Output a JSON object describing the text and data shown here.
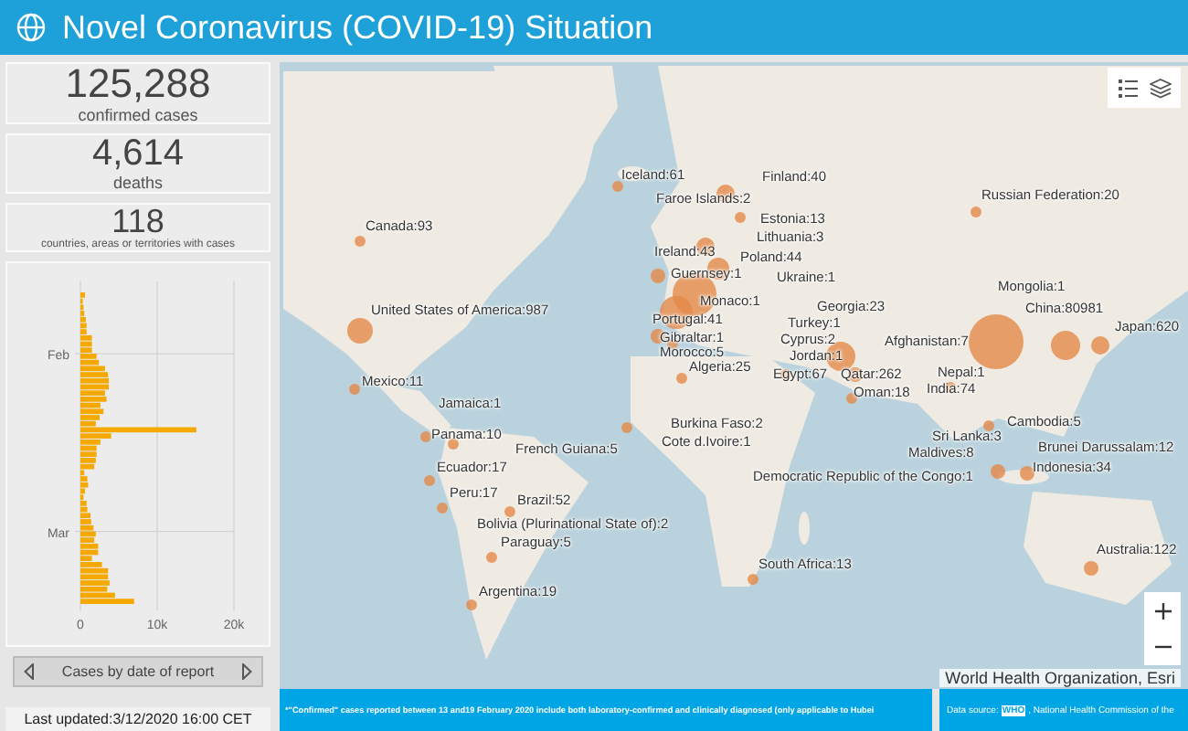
{
  "header": {
    "title": "Novel Coronavirus (COVID-19) Situation"
  },
  "stats": [
    {
      "value": "125,288",
      "label": "confirmed cases"
    },
    {
      "value": "4,614",
      "label": "deaths"
    },
    {
      "value": "118",
      "label": "countries, areas or territories with cases"
    }
  ],
  "chart": {
    "month_labels": [
      "Feb",
      "Mar"
    ],
    "value_labels": [
      "0",
      "10k",
      "20k"
    ]
  },
  "carousel": {
    "label": "Cases by date of report"
  },
  "last_updated": "Last updated:3/12/2020 16:00 CET",
  "map": {
    "labels": [
      {
        "text": "Iceland:61"
      },
      {
        "text": "Faroe Islands:2"
      },
      {
        "text": "Finland:40"
      },
      {
        "text": "Estonia:13"
      },
      {
        "text": "Lithuania:3"
      },
      {
        "text": "Poland:44"
      },
      {
        "text": "Ukraine:1"
      },
      {
        "text": "Ireland:43"
      },
      {
        "text": "Guernsey:1"
      },
      {
        "text": "Monaco:1"
      },
      {
        "text": "Portugal:41"
      },
      {
        "text": "Gibraltar:1"
      },
      {
        "text": "Morocco:5"
      },
      {
        "text": "Algeria:25"
      },
      {
        "text": "Georgia:23"
      },
      {
        "text": "Turkey:1"
      },
      {
        "text": "Cyprus:2"
      },
      {
        "text": "Jordan:1"
      },
      {
        "text": "Egypt:67"
      },
      {
        "text": "Qatar:262"
      },
      {
        "text": "Afghanistan:7"
      },
      {
        "text": "Oman:18"
      },
      {
        "text": "Nepal:1"
      },
      {
        "text": "India:74"
      },
      {
        "text": "Mongolia:1"
      },
      {
        "text": "China:80981"
      },
      {
        "text": "Japan:620"
      },
      {
        "text": "Russian Federation:20"
      },
      {
        "text": "Canada:93"
      },
      {
        "text": "United States of America:987"
      },
      {
        "text": "Mexico:11"
      },
      {
        "text": "Jamaica:1"
      },
      {
        "text": "Panama:10"
      },
      {
        "text": "French Guiana:5"
      },
      {
        "text": "Ecuador:17"
      },
      {
        "text": "Peru:17"
      },
      {
        "text": "Brazil:52"
      },
      {
        "text": "Bolivia (Plurinational State of):2"
      },
      {
        "text": "Paraguay:5"
      },
      {
        "text": "Argentina:19"
      },
      {
        "text": "Burkina Faso:2"
      },
      {
        "text": "Cote d.Ivoire:1"
      },
      {
        "text": "Cambodia:5"
      },
      {
        "text": "Sri Lanka:3"
      },
      {
        "text": "Brunei Darussalam:12"
      },
      {
        "text": "Maldives:8"
      },
      {
        "text": "Indonesia:34"
      },
      {
        "text": "Democratic Republic of the Congo:1"
      },
      {
        "text": "South Africa:13"
      },
      {
        "text": "Australia:122"
      }
    ],
    "attribution": "World Health Organization, Esri"
  },
  "footer": {
    "note": "*\"Confirmed\" cases reported between 13 and19 February 2020 include both laboratory-confirmed and clinically diagnosed (only  applicable to Hubei",
    "source_prefix": "Data source:",
    "source_link": "WHO",
    "source_suffix": ", National Health Commission of the"
  }
}
